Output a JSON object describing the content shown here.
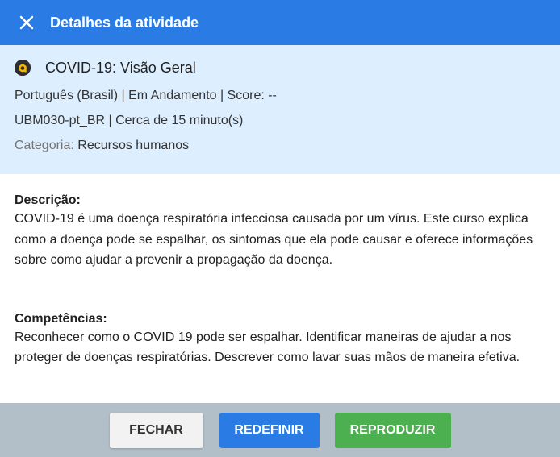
{
  "header": {
    "title": "Detalhes da atividade",
    "close_icon": "close-icon"
  },
  "course": {
    "logo_icon": "brand-logo-icon",
    "title": "COVID-19: Visão Geral",
    "meta_line": "Português (Brasil) | Em Andamento | Score: --",
    "code_line": "UBM030-pt_BR | Cerca de 15 minuto(s)",
    "category_label": "Categoria:",
    "category_value": "Recursos humanos"
  },
  "description": {
    "heading": "Descrição:",
    "text": "COVID-19 é uma doença respiratória infecciosa causada por um vírus. Este curso explica como a doença pode se espalhar, os sintomas que ela pode causar e oferece informações sobre como ajudar a prevenir a propagação da doença."
  },
  "competencies": {
    "heading": "Competências:",
    "text": "Reconhecer como o COVID 19 pode ser espalhar. Identificar maneiras de ajudar a nos proteger de doenças respiratórias. Descrever como lavar suas mãos de maneira efetiva."
  },
  "footer": {
    "close_label": "FECHAR",
    "reset_label": "REDEFINIR",
    "play_label": "REPRODUZIR"
  },
  "colors": {
    "header": "#2a7be4",
    "info_panel": "#ddeeff",
    "footer": "#b2bfc8",
    "play_button": "#4caf50"
  }
}
